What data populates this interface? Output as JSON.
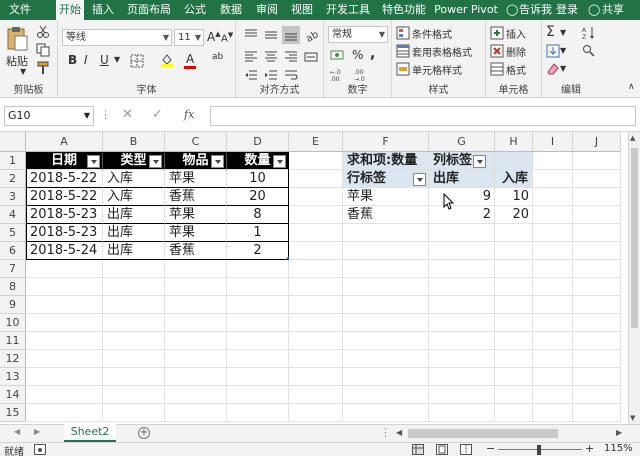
{
  "tabs": [
    "文件",
    "开始",
    "插入",
    "页面布局",
    "公式",
    "数据",
    "审阅",
    "视图",
    "开发工具",
    "特色功能",
    "Power Pivot"
  ],
  "active_tab": 1,
  "tell_me": "告诉我",
  "login": "登录",
  "share": "共享",
  "ribbon": {
    "paste_label": "粘贴",
    "clipboard_label": "剪贴板",
    "font_name": "等线",
    "font_size": "11",
    "font_label": "字体",
    "align_label": "对齐方式",
    "number_format": "常规",
    "number_label": "数字",
    "cond_format": "条件格式",
    "table_format": "套用表格格式",
    "cell_style": "单元格样式",
    "style_label": "样式",
    "insert": "插入",
    "delete": "删除",
    "format": "格式",
    "cells_label": "单元格",
    "edit_label": "编辑",
    "bold": "B",
    "italic": "I",
    "underline": "U",
    "wrap": "ab",
    "percent": "%",
    "comma": ","
  },
  "formula_bar": {
    "name_box": "G10",
    "fx": "fx",
    "value": ""
  },
  "columns": [
    "A",
    "B",
    "C",
    "D",
    "E",
    "F",
    "G",
    "H",
    "I",
    "J"
  ],
  "rows": [
    "1",
    "2",
    "3",
    "4",
    "5",
    "6",
    "7",
    "8",
    "9",
    "10",
    "11",
    "12",
    "13",
    "14",
    "15"
  ],
  "table": {
    "headers": [
      "日期",
      "类型",
      "物品",
      "数量"
    ],
    "rows": [
      [
        "2018-5-22",
        "入库",
        "苹果",
        "10"
      ],
      [
        "2018-5-22",
        "入库",
        "香蕉",
        "20"
      ],
      [
        "2018-5-23",
        "出库",
        "苹果",
        "8"
      ],
      [
        "2018-5-23",
        "出库",
        "苹果",
        "1"
      ],
      [
        "2018-5-24",
        "出库",
        "香蕉",
        "2"
      ]
    ]
  },
  "pivot": {
    "title": "求和项:数量",
    "col_label": "列标签",
    "row_label": "行标签",
    "col_out": "出库",
    "col_in": "入库",
    "rows": [
      {
        "name": "苹果",
        "out": "9",
        "in": "10"
      },
      {
        "name": "香蕉",
        "out": "2",
        "in": "20"
      }
    ]
  },
  "sheet_tab": "Sheet2",
  "status": {
    "ready": "就绪",
    "zoom": "115%"
  },
  "colors": {
    "excel_green": "#217346",
    "pivot_header": "#dce6f1"
  }
}
